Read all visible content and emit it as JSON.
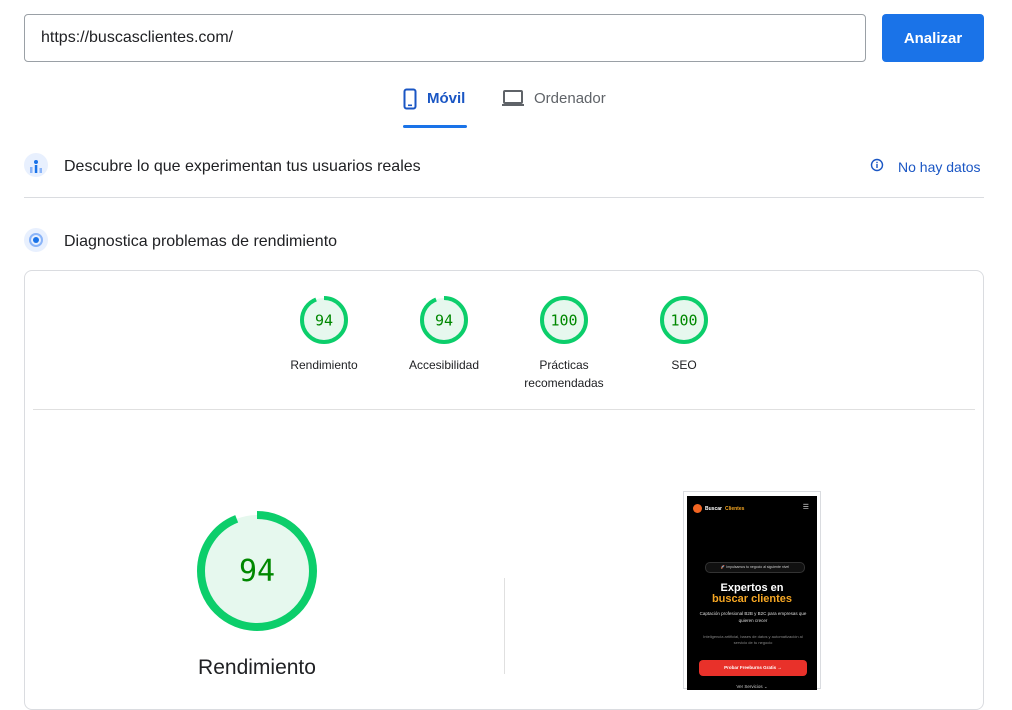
{
  "url_bar": {
    "value": "https://buscasclientes.com/"
  },
  "analyze_button": {
    "label": "Analizar"
  },
  "tabs": [
    {
      "label": "Móvil",
      "icon": "phone-icon",
      "active": true
    },
    {
      "label": "Ordenador",
      "icon": "laptop-icon",
      "active": false
    }
  ],
  "field_data": {
    "title": "Descubre lo que experimentan tus usuarios reales",
    "status": "No hay datos",
    "icon": "users-chart-icon"
  },
  "diagnostics": {
    "title": "Diagnostica problemas de rendimiento",
    "icon": "gauge-icon"
  },
  "scores": [
    {
      "value": "94",
      "label": "Rendimiento",
      "fraction": 0.94
    },
    {
      "value": "94",
      "label": "Accesibilidad",
      "fraction": 0.94
    },
    {
      "value": "100",
      "label": "Prácticas recomendadas",
      "fraction": 1.0
    },
    {
      "value": "100",
      "label": "SEO",
      "fraction": 1.0
    }
  ],
  "main_score": {
    "value": "94",
    "label": "Rendimiento",
    "fraction": 0.94
  },
  "colors": {
    "pass": "#0cce6b",
    "pass_text": "#008800",
    "accent": "#1a73e8"
  },
  "preview": {
    "brand_a": "Buscar",
    "brand_b": "Clientes",
    "pill": "🚀 Impulsamos tu negocio al siguiente nivel",
    "heading_line1": "Expertos en",
    "heading_line2": "buscar clientes",
    "text1": "Captación profesional B2B y B2C para empresas que quieren crecer",
    "text2": "Inteligencia artificial, bases de datos y automatización al servicio de tu negocio",
    "cta": "Probar Freeburns Gratis →",
    "link": "Ver Servicios ⌄"
  }
}
